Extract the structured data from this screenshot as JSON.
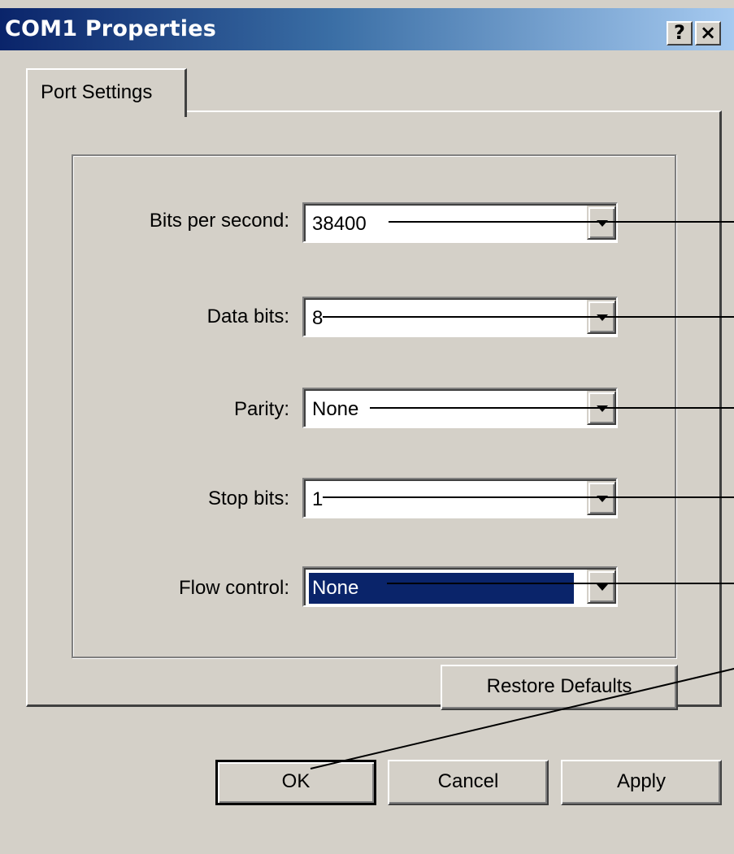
{
  "window": {
    "title": "COM1 Properties",
    "help_glyph": "?",
    "close_glyph": "×"
  },
  "tabs": [
    {
      "label": "Port Settings",
      "active": true
    }
  ],
  "port_settings": {
    "bits_per_second": {
      "label": "Bits per second:",
      "value": "38400"
    },
    "data_bits": {
      "label": "Data bits:",
      "value": "8"
    },
    "parity": {
      "label": "Parity:",
      "value": "None"
    },
    "stop_bits": {
      "label": "Stop bits:",
      "value": "1"
    },
    "flow_control": {
      "label": "Flow control:",
      "value": "None",
      "selected": true
    },
    "restore_defaults_label": "Restore Defaults"
  },
  "footer": {
    "ok_label": "OK",
    "cancel_label": "Cancel",
    "apply_label": "Apply"
  },
  "colors": {
    "face": "#d4d0c8",
    "title_start": "#0a246a",
    "title_end": "#a6caf0",
    "selection": "#0a246a"
  }
}
